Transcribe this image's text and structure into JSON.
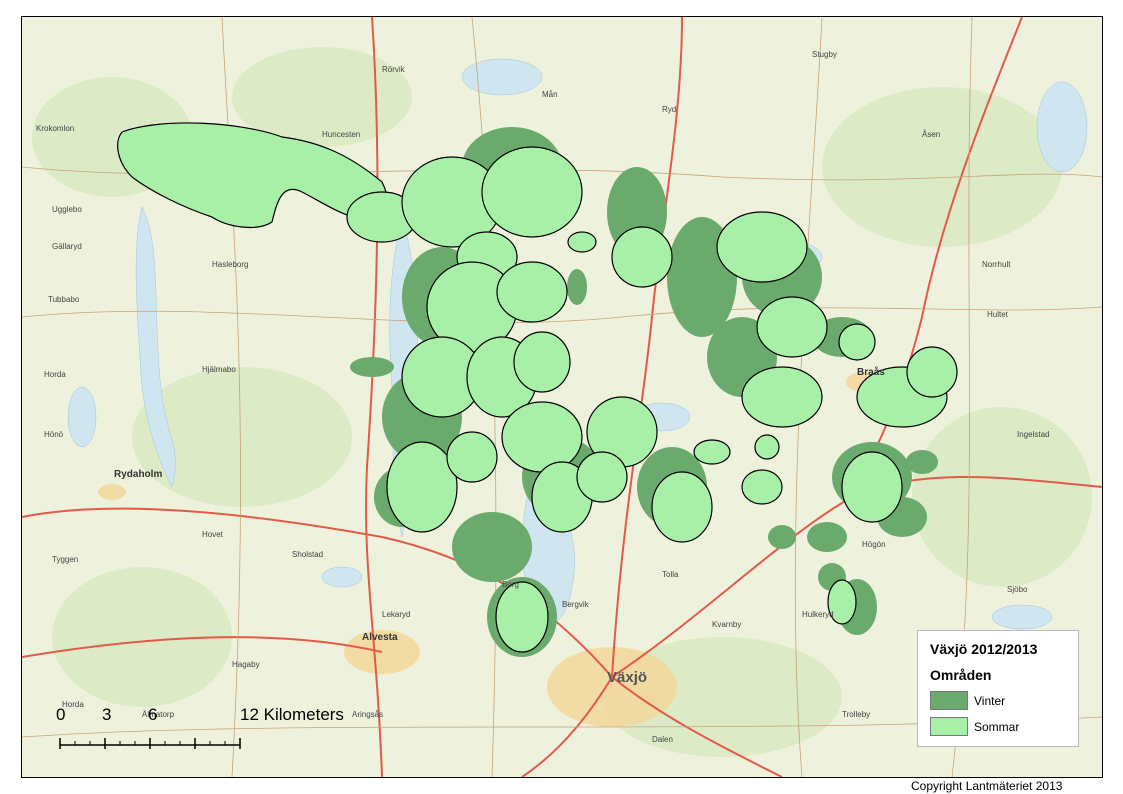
{
  "legend": {
    "title": "Växjö 2012/2013",
    "subtitle": "Områden",
    "items": [
      {
        "label": "Vinter",
        "color": "#6aaa6d"
      },
      {
        "label": "Sommar",
        "color": "#a8efa8"
      }
    ]
  },
  "scale_bar": {
    "labels": [
      "0",
      "3",
      "6",
      "12 Kilometers"
    ]
  },
  "copyright": "Copyright Lantmäteriet 2013",
  "map": {
    "city_label": "Växjö",
    "town_labels": [
      "Alvesta",
      "Rydaholm",
      "Braås"
    ],
    "colors": {
      "background": "#eef2dc",
      "water": "#cfe5f0",
      "forest": "#dceac6",
      "road": "#e45a4a",
      "urban": "#f3d79a",
      "winter": "#6aaa6d",
      "summer": "#a8efa8"
    },
    "icons": [
      "scale-bar-icon",
      "legend-swatch-icon"
    ]
  }
}
